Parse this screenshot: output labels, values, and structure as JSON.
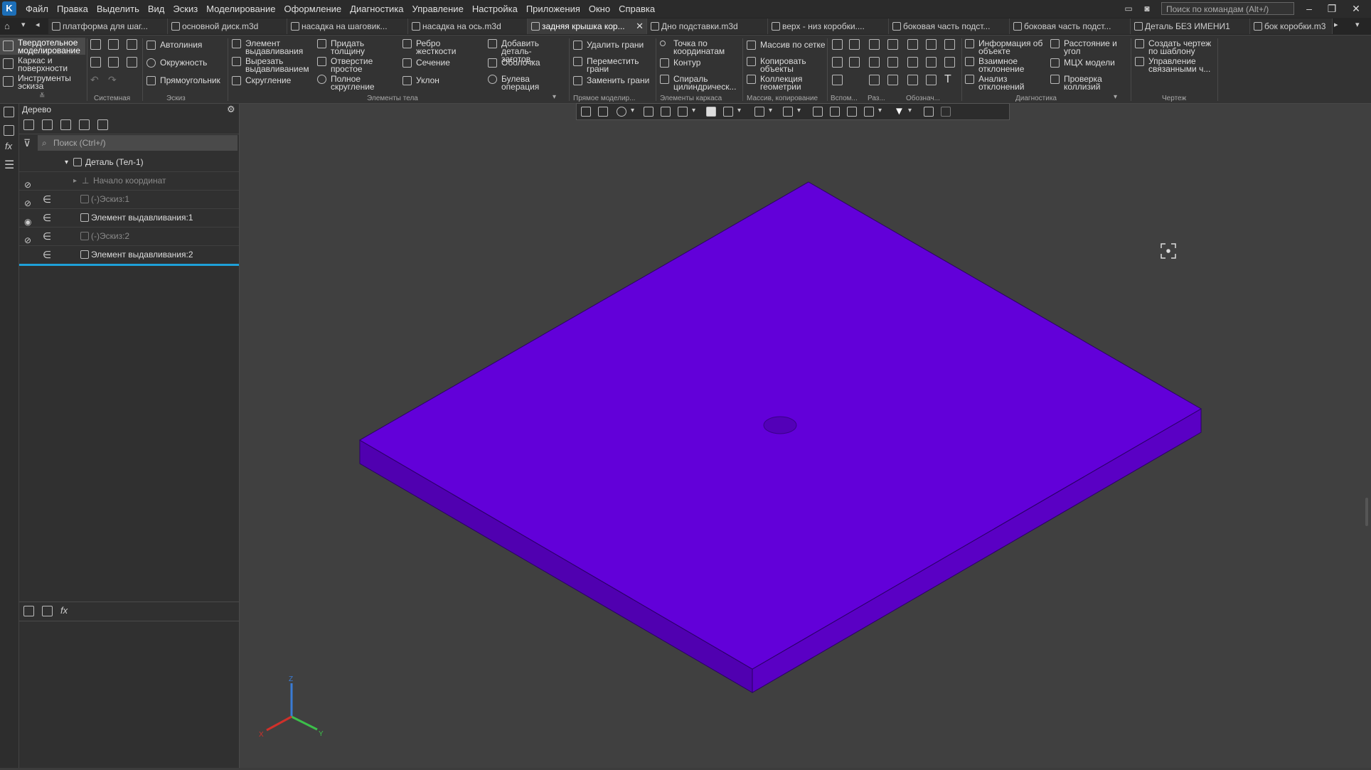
{
  "menu": [
    "Файл",
    "Правка",
    "Выделить",
    "Вид",
    "Эскиз",
    "Моделирование",
    "Оформление",
    "Диагностика",
    "Управление",
    "Настройка",
    "Приложения",
    "Окно",
    "Справка"
  ],
  "app_logo": "K",
  "command_search_placeholder": "Поиск по командам (Alt+/)",
  "tabs": [
    {
      "label": "платформа для шаг..."
    },
    {
      "label": "основной диск.m3d"
    },
    {
      "label": "насадка на шаговик..."
    },
    {
      "label": "насадка на ось.m3d"
    },
    {
      "label": "задняя крышка кор...",
      "active": true
    },
    {
      "label": "Дно подставки.m3d"
    },
    {
      "label": "верх - низ коробки...."
    },
    {
      "label": "боковая часть подст..."
    },
    {
      "label": "боковая часть подст..."
    },
    {
      "label": "Деталь БЕЗ ИМЕНИ1"
    },
    {
      "label": "бок коробки.m3"
    }
  ],
  "ribbon": {
    "modes": [
      "Твердотельное моделирование",
      "Каркас и поверхности",
      "Инструменты эскиза"
    ],
    "groups": {
      "system": "Системная",
      "sketch": "Эскиз",
      "body": "Элементы тела",
      "direct": "Прямое моделир...",
      "frame": "Элементы каркаса",
      "array": "Массив, копирование",
      "aux": "Вспом...",
      "size": "Раз...",
      "notation": "Обознач...",
      "diag": "Диагностика",
      "drawing": "Чертеж"
    },
    "sketch_buttons": [
      "Автолиния",
      "Окружность",
      "Прямоугольник"
    ],
    "body_buttons": [
      "Элемент выдавливания",
      "Вырезать выдавливанием",
      "Скругление",
      "Придать толщину",
      "Отверстие простое",
      "Полное скругление",
      "Ребро жесткости",
      "Сечение",
      "Уклон",
      "Добавить деталь-заготов...",
      "Оболочка",
      "Булева операция"
    ],
    "direct_buttons": [
      "Удалить грани",
      "Переместить грани",
      "Заменить грани"
    ],
    "frame_buttons": [
      "Точка по координатам",
      "Контур",
      "Спираль цилиндрическ..."
    ],
    "array_buttons": [
      "Массив по сетке",
      "Копировать объекты",
      "Коллекция геометрии"
    ],
    "diag_buttons": [
      "Информация об объекте",
      "Взаимное отклонение",
      "Анализ отклонений",
      "Расстояние и угол",
      "МЦХ модели",
      "Проверка коллизий"
    ],
    "drawing_buttons": [
      "Создать чертеж по шаблону",
      "Управление связанными ч..."
    ]
  },
  "tree": {
    "title": "Дерево",
    "search_placeholder": "Поиск (Ctrl+/)",
    "items": [
      {
        "label": "Деталь (Тел-1)"
      },
      {
        "label": "Начало координат"
      },
      {
        "label": "(-)Эскиз:1"
      },
      {
        "label": "Элемент выдавливания:1"
      },
      {
        "label": "(-)Эскиз:2"
      },
      {
        "label": "Элемент выдавливания:2"
      }
    ]
  },
  "bottom_tabs_fx": "fx",
  "axes": {
    "x": "X",
    "y": "Y",
    "z": "Z"
  },
  "colors": {
    "part": "#6200d9",
    "part_side_left": "#5000b0",
    "part_side_right": "#5a00c4",
    "accent": "#1ea0d8"
  }
}
